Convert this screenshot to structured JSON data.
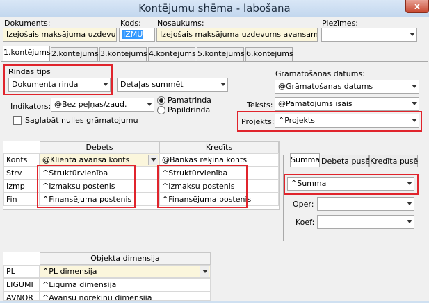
{
  "window": {
    "title": "Kontējumu shēma - labošana",
    "close": "x"
  },
  "header": {
    "dokuments_label": "Dokuments:",
    "dokuments_value": "Izejošais maksājuma uzdevums",
    "kods_label": "Kods:",
    "kods_value": "IZMU",
    "nosaukums_label": "Nosaukums:",
    "nosaukums_value": "Izejošais maksājuma uzdevums avansam",
    "piezimes_label": "Piezīmes:",
    "piezimes_value": ""
  },
  "tabs": [
    "1.kontējums",
    "2.kontējums",
    "3.kontējums",
    "4.kontējums",
    "5.kontējums",
    "6.kontējums"
  ],
  "rindas": {
    "label": "Rindas tips",
    "value": "Dokumenta rinda",
    "detalas_value": "Detaļas summēt"
  },
  "indikators": {
    "label": "Indikators:",
    "value": "@Bez peļņas/zaud.",
    "radio_pamatrinda": "Pamatrinda",
    "radio_papildrinda": "Papildrinda",
    "saglabat_label": "Saglabāt nulles grāmatojumu"
  },
  "gramatosanas": {
    "label": "Grāmatošanas datums:",
    "value": "@Grāmatošanas datums",
    "teksts_label": "Teksts:",
    "teksts_value": "@Pamatojums īsais",
    "projekts_label": "Projekts:",
    "projekts_value": "^Projekts"
  },
  "grid": {
    "debets_header": "Debets",
    "kredits_header": "Kredīts",
    "rows": [
      {
        "label": "Konts",
        "debets": "@Klienta avansa konts",
        "kredits": "@Bankas rēķina konts"
      },
      {
        "label": "Strv",
        "debets": "^Struktūrvienība",
        "kredits": "^Struktūrvienība"
      },
      {
        "label": "Izmp",
        "debets": "^Izmaksu postenis",
        "kredits": "^Izmaksu postenis"
      },
      {
        "label": "Fin",
        "debets": "^Finansējuma postenis",
        "kredits": "^Finansējuma postenis"
      }
    ]
  },
  "summa_panel": {
    "tabs": [
      "Summa",
      "Debeta pusē",
      "Kredīta pusē"
    ],
    "summa_value": "^Summa",
    "oper_label": "Oper:",
    "oper_value": "",
    "koef_label": "Koef:",
    "koef_value": ""
  },
  "objekta": {
    "header": "Objekta dimensija",
    "rows": [
      {
        "label": "PL",
        "value": "^PL dimensija"
      },
      {
        "label": "LIGUMI",
        "value": "^Līguma dimensija"
      },
      {
        "label": "AVNOR",
        "value": "^Avansu norēķinu dimensija"
      }
    ]
  },
  "colors": {
    "highlight_red": "#e0242c",
    "selection_blue": "#3399ff",
    "field_yellow": "#fbf6dc"
  }
}
